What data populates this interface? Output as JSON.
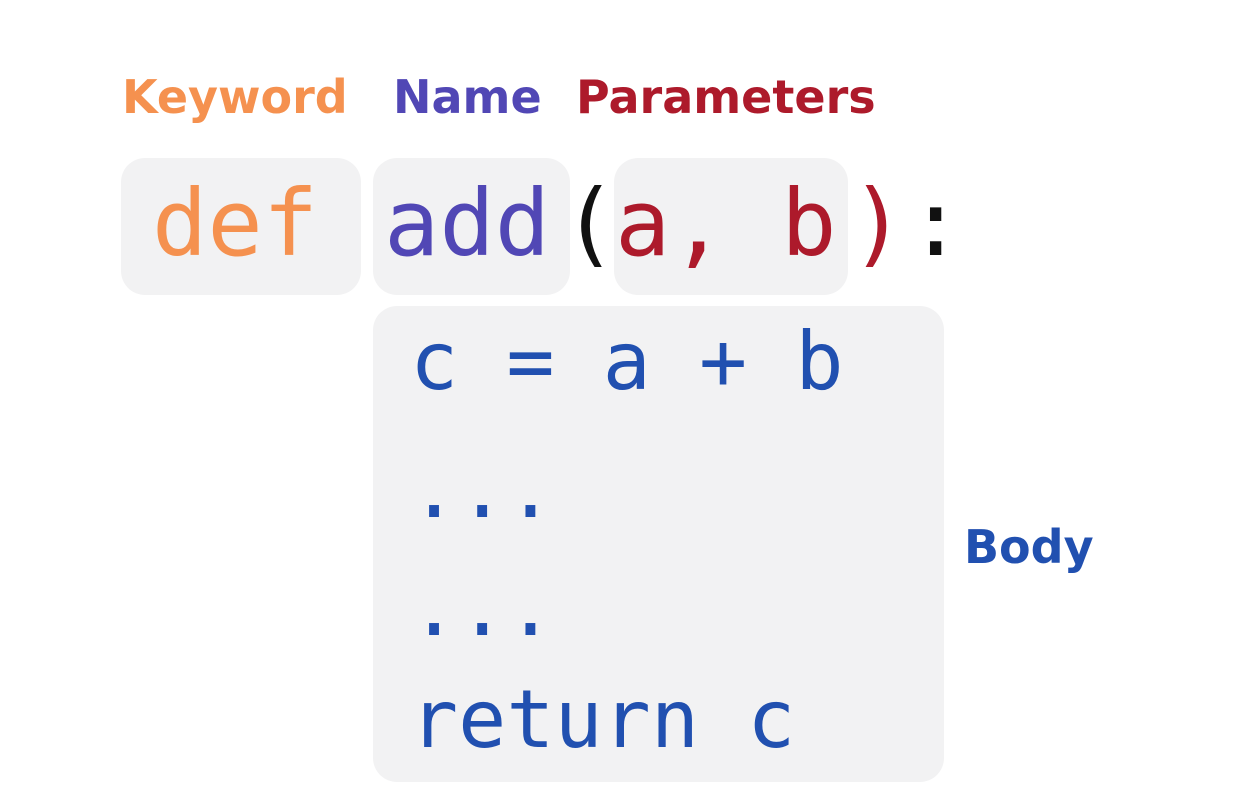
{
  "labels": {
    "keyword": "Keyword",
    "name": "Name",
    "parameters": "Parameters",
    "body": "Body"
  },
  "signature": {
    "keyword": "def",
    "name": "add",
    "open_paren": "(",
    "params": "a, b",
    "close_paren": ")",
    "colon": ":"
  },
  "body_lines": [
    "c = a + b",
    "...",
    "...",
    "return c"
  ],
  "colors": {
    "keyword": "#f5914f",
    "name": "#5147b5",
    "parameters": "#ad1a2b",
    "body": "#2150b0",
    "punctuation": "#111111",
    "box_background": "#f2f2f3"
  }
}
